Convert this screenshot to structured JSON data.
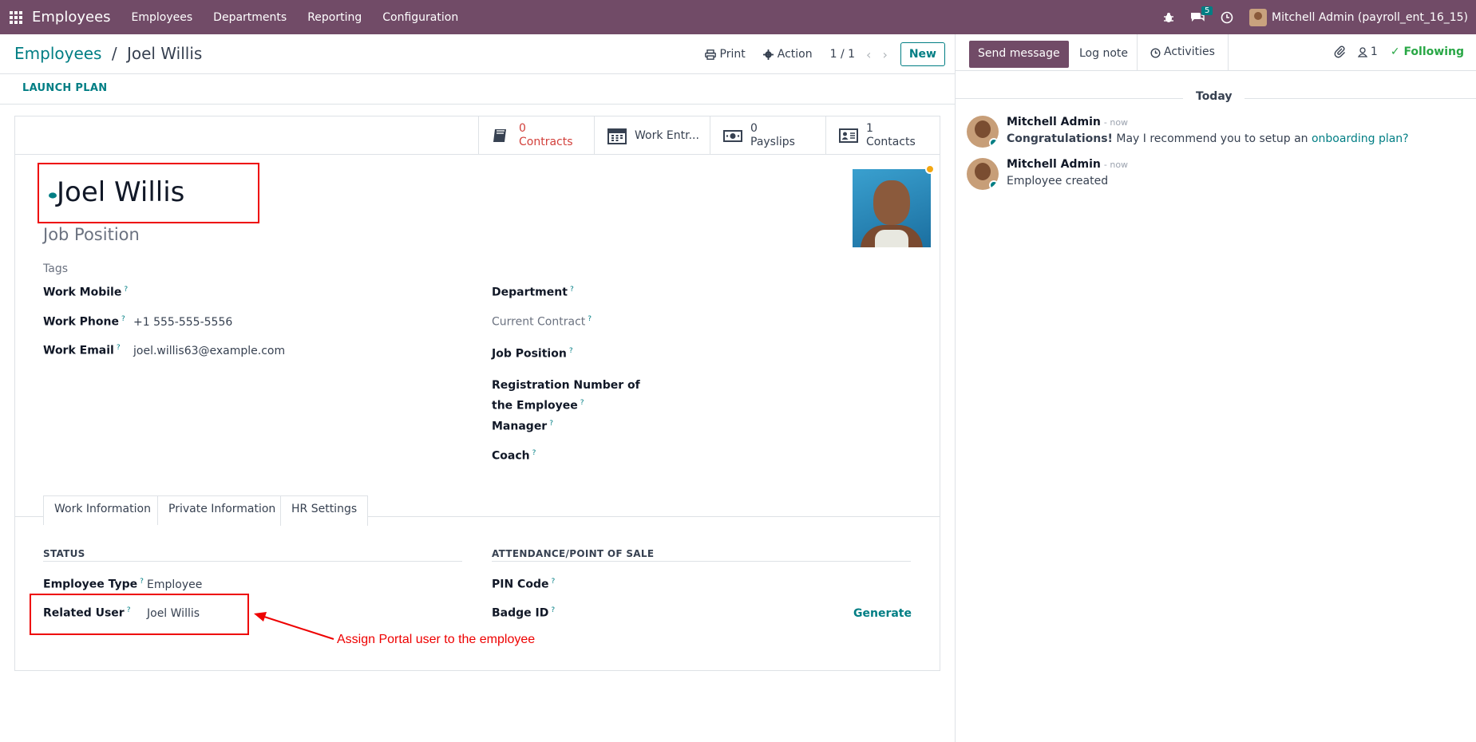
{
  "nav": {
    "brand": "Employees",
    "menu": [
      "Employees",
      "Departments",
      "Reporting",
      "Configuration"
    ],
    "messages_count": "5",
    "user": "Mitchell Admin (payroll_ent_16_15)"
  },
  "control_panel": {
    "breadcrumb_root": "Employees",
    "breadcrumb_sep": "/",
    "breadcrumb_current": "Joel Willis",
    "print_label": "Print",
    "action_label": "Action",
    "pager": "1 / 1",
    "new_label": "New"
  },
  "launch_plan": "LAUNCH PLAN",
  "stats": [
    {
      "num": "0",
      "label": "Contracts"
    },
    {
      "num": "",
      "label": "Work Entr..."
    },
    {
      "num": "0",
      "label": "Payslips"
    },
    {
      "num": "1",
      "label": "Contacts"
    }
  ],
  "employee": {
    "name": "Joel Willis",
    "job_position_placeholder": "Job Position",
    "tags_placeholder": "Tags"
  },
  "left_fields": [
    {
      "label": "Work Mobile",
      "value": ""
    },
    {
      "label": "Work Phone",
      "value": "+1 555-555-5556"
    },
    {
      "label": "Work Email",
      "value": "joel.willis63@example.com"
    }
  ],
  "right_fields": {
    "department": "Department",
    "current_contract": "Current Contract",
    "job_position": "Job Position",
    "registration_line1": "Registration Number of",
    "registration_line2": "the Employee",
    "manager": "Manager",
    "coach": "Coach"
  },
  "tabs": [
    "Work Information",
    "Private Information",
    "HR Settings"
  ],
  "hr_settings": {
    "status_title": "STATUS",
    "attendance_title": "ATTENDANCE/POINT OF SALE",
    "employee_type_label": "Employee Type",
    "employee_type_value": "Employee",
    "related_user_label": "Related User",
    "related_user_value": "Joel Willis",
    "pin_label": "PIN Code",
    "badge_label": "Badge ID",
    "generate_label": "Generate"
  },
  "annotation": "Assign Portal user to the employee",
  "chatter": {
    "send_message": "Send message",
    "log_note": "Log note",
    "activities": "Activities",
    "followers_count": "1",
    "following": "Following",
    "today": "Today",
    "messages": [
      {
        "author": "Mitchell Admin",
        "time": "- now",
        "bold": "Congratulations!",
        "text": " May I recommend you to setup an ",
        "link": "onboarding plan?"
      },
      {
        "author": "Mitchell Admin",
        "time": "- now",
        "text": "Employee created"
      }
    ]
  },
  "colors": {
    "brand": "#714B67",
    "accent": "#017e84",
    "danger": "#d23f3a",
    "success": "#28a745"
  }
}
